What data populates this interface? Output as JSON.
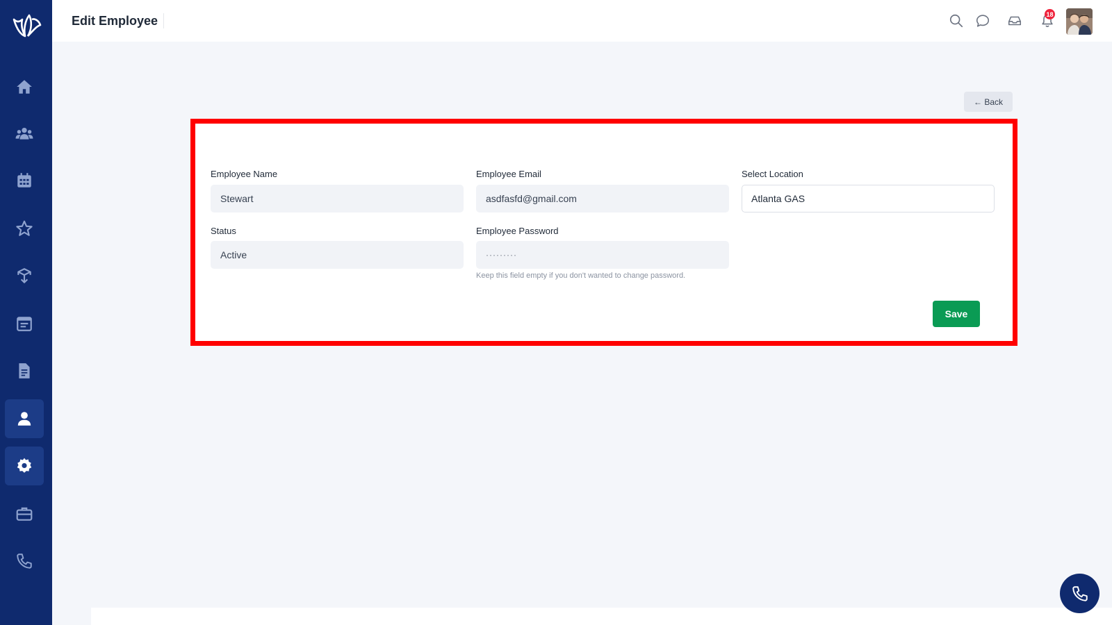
{
  "header": {
    "title": "Edit Employee",
    "notification_count": "18",
    "icons": [
      "search-icon",
      "chat-icon",
      "inbox-icon",
      "bell-icon"
    ]
  },
  "sidebar": {
    "items": [
      {
        "icon": "home-icon"
      },
      {
        "icon": "users-icon"
      },
      {
        "icon": "calendar-icon"
      },
      {
        "icon": "star-icon"
      },
      {
        "icon": "box-icon"
      },
      {
        "icon": "schedule-icon"
      },
      {
        "icon": "document-icon"
      },
      {
        "icon": "user-icon",
        "active": true
      },
      {
        "icon": "gear-icon",
        "active": true
      },
      {
        "icon": "briefcase-icon"
      },
      {
        "icon": "phone-icon"
      }
    ]
  },
  "back_button": {
    "label": "← Back"
  },
  "form": {
    "employee_name": {
      "label": "Employee Name",
      "value": "Stewart"
    },
    "employee_email": {
      "label": "Employee Email",
      "value": "asdfasfd@gmail.com"
    },
    "location": {
      "label": "Select Location",
      "value": "Atlanta GAS"
    },
    "status": {
      "label": "Status",
      "value": "Active"
    },
    "password": {
      "label": "Employee Password",
      "value": "·········",
      "hint": "Keep this field empty if you don't wanted to change password."
    },
    "save_label": "Save"
  },
  "colors": {
    "sidebar": "#0f2a6e",
    "save": "#0a9b54",
    "highlight": "#ff0000",
    "badge": "#ef233c"
  }
}
